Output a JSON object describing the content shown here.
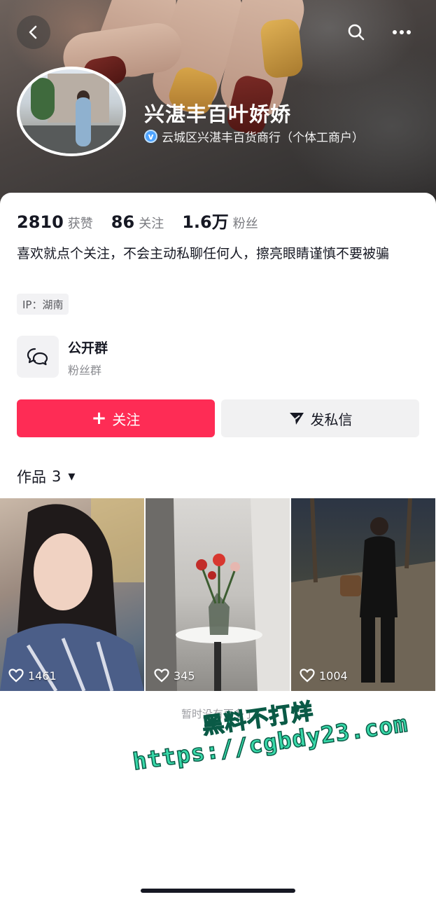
{
  "header": {
    "display_name": "兴湛丰百叶娇娇",
    "verification": "云城区兴湛丰百货商行（个体工商户）",
    "verify_icon": "verified-v-icon"
  },
  "stats": [
    {
      "value": "2810",
      "label": "获赞"
    },
    {
      "value": "86",
      "label": "关注"
    },
    {
      "value": "1.6万",
      "label": "粉丝"
    }
  ],
  "bio": "喜欢就点个关注，不会主动私聊任何人，擦亮眼睛谨慎不要被骗",
  "ip_location": "IP：湖南",
  "group": {
    "title": "公开群",
    "subtitle": "粉丝群"
  },
  "actions": {
    "follow_label": "关注",
    "message_label": "发私信"
  },
  "works": {
    "tab_label": "作品",
    "count": "3",
    "items": [
      {
        "likes": "1461"
      },
      {
        "likes": "345"
      },
      {
        "likes": "1004"
      }
    ],
    "empty_hint": "暂时没有更多了"
  },
  "watermark": {
    "line1": "黑料不打烊",
    "line2": "https://cgbdy23.com"
  },
  "colors": {
    "accent": "#fe2c55",
    "verify": "#4da3ff",
    "watermark": "#38d9a9"
  }
}
